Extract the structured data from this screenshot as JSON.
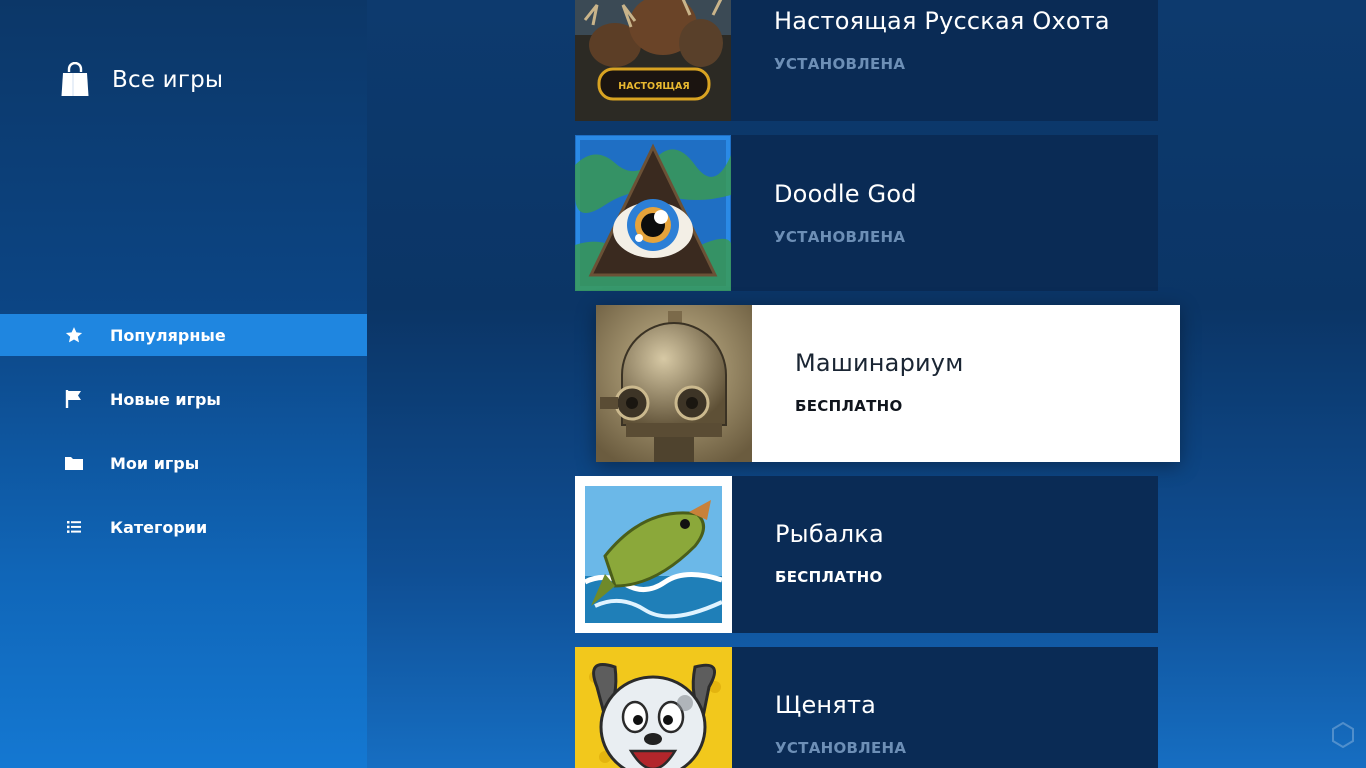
{
  "sidebar": {
    "title": "Все игры",
    "title_icon": "shopping-bag-icon",
    "items": [
      {
        "label": "Популярные",
        "icon": "star-icon",
        "active": true
      },
      {
        "label": "Новые игры",
        "icon": "flag-icon",
        "active": false
      },
      {
        "label": "Мои игры",
        "icon": "folder-icon",
        "active": false
      },
      {
        "label": "Категории",
        "icon": "list-icon",
        "active": false
      }
    ]
  },
  "games": [
    {
      "title": "Настоящая Русская Охота",
      "status": "УСТАНОВЛЕНА",
      "thumb_icon": "hunting-game-thumbnail",
      "thumb_text": "НАСТОЯЩАЯ"
    },
    {
      "title": "Doodle God",
      "status": "УСТАНОВЛЕНА",
      "thumb_icon": "eye-pyramid-thumbnail"
    },
    {
      "title": "Машинариум",
      "status": "БЕСПЛАТНО",
      "thumb_icon": "robot-head-thumbnail",
      "focused": true
    },
    {
      "title": "Рыбалка",
      "status": "БЕСПЛАТНО",
      "thumb_icon": "fish-thumbnail"
    },
    {
      "title": "Щенята",
      "status": "УСТАНОВЛЕНА",
      "thumb_icon": "puppy-thumbnail"
    }
  ],
  "colors": {
    "sidebar_active": "#1f86e0",
    "card_bg": "#0a2b55",
    "focused_card_bg": "#ffffff",
    "installed_status": "#6d8fb6"
  }
}
